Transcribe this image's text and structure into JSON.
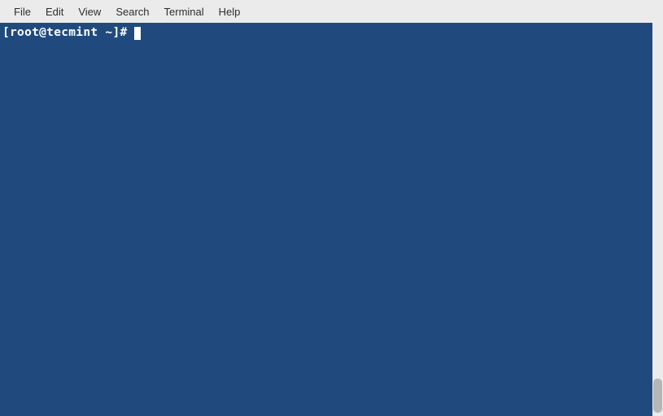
{
  "menubar": {
    "items": [
      {
        "label": "File"
      },
      {
        "label": "Edit"
      },
      {
        "label": "View"
      },
      {
        "label": "Search"
      },
      {
        "label": "Terminal"
      },
      {
        "label": "Help"
      }
    ]
  },
  "terminal": {
    "prompt": "[root@tecmint ~]#",
    "background": "#204a7d",
    "text_color": "#ffffff"
  }
}
